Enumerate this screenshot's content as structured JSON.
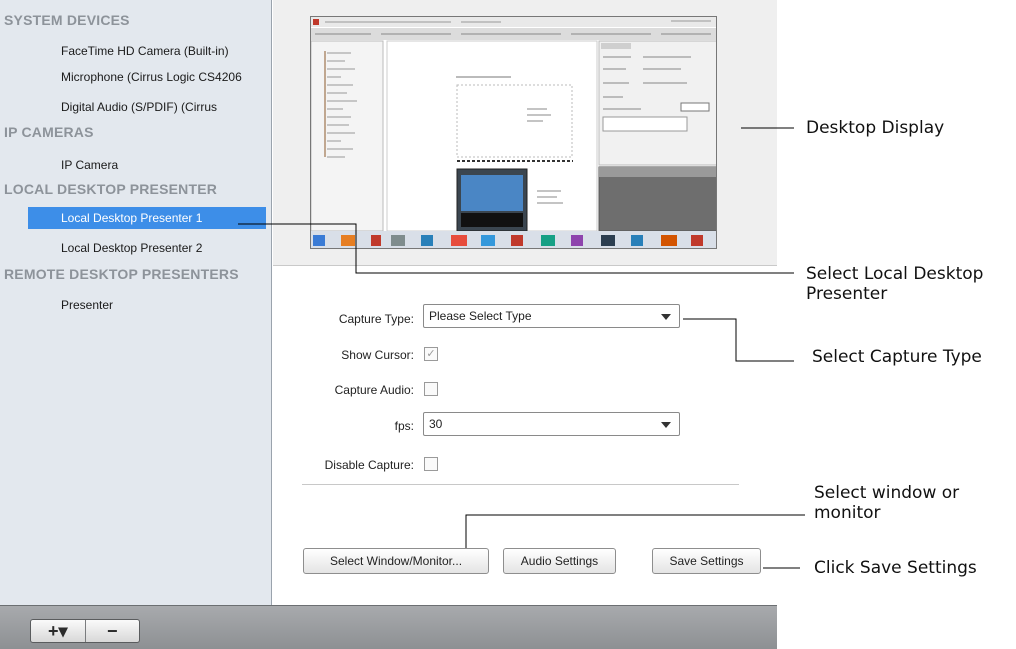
{
  "sidebar": {
    "groups": [
      {
        "title": "SYSTEM DEVICES",
        "items": [
          "FaceTime HD Camera (Built-in)",
          "Microphone (Cirrus Logic CS4206",
          "Digital Audio (S/PDIF) (Cirrus"
        ]
      },
      {
        "title": "IP CAMERAS",
        "items": [
          "IP Camera"
        ]
      },
      {
        "title": "LOCAL DESKTOP PRESENTER",
        "items": [
          "Local Desktop Presenter 1",
          "Local Desktop Presenter 2"
        ]
      },
      {
        "title": "REMOTE DESKTOP PRESENTERS",
        "items": [
          "Presenter"
        ]
      }
    ],
    "selected_item": "Local Desktop Presenter 1"
  },
  "toolbar": {
    "add_label": "+▾",
    "remove_label": "−"
  },
  "form": {
    "capture_type_label": "Capture Type:",
    "capture_type_value": "Please Select Type",
    "show_cursor_label": "Show Cursor:",
    "show_cursor_checked": true,
    "capture_audio_label": "Capture Audio:",
    "capture_audio_checked": false,
    "fps_label": "fps:",
    "fps_value": "30",
    "disable_capture_label": "Disable Capture:",
    "disable_capture_checked": false
  },
  "buttons": {
    "select_window": "Select Window/Monitor...",
    "audio_settings": "Audio Settings",
    "save_settings": "Save Settings"
  },
  "annotations": {
    "desktop_display": "Desktop Display",
    "select_presenter": "Select Local Desktop Presenter",
    "select_capture_type": "Select Capture Type",
    "select_window": "Select window or monitor",
    "save_settings": "Click Save Settings"
  },
  "colors": {
    "selection": "#3d8ee8",
    "sidebar_bg": "#e3e8ee",
    "group_header": "#8d939a"
  }
}
